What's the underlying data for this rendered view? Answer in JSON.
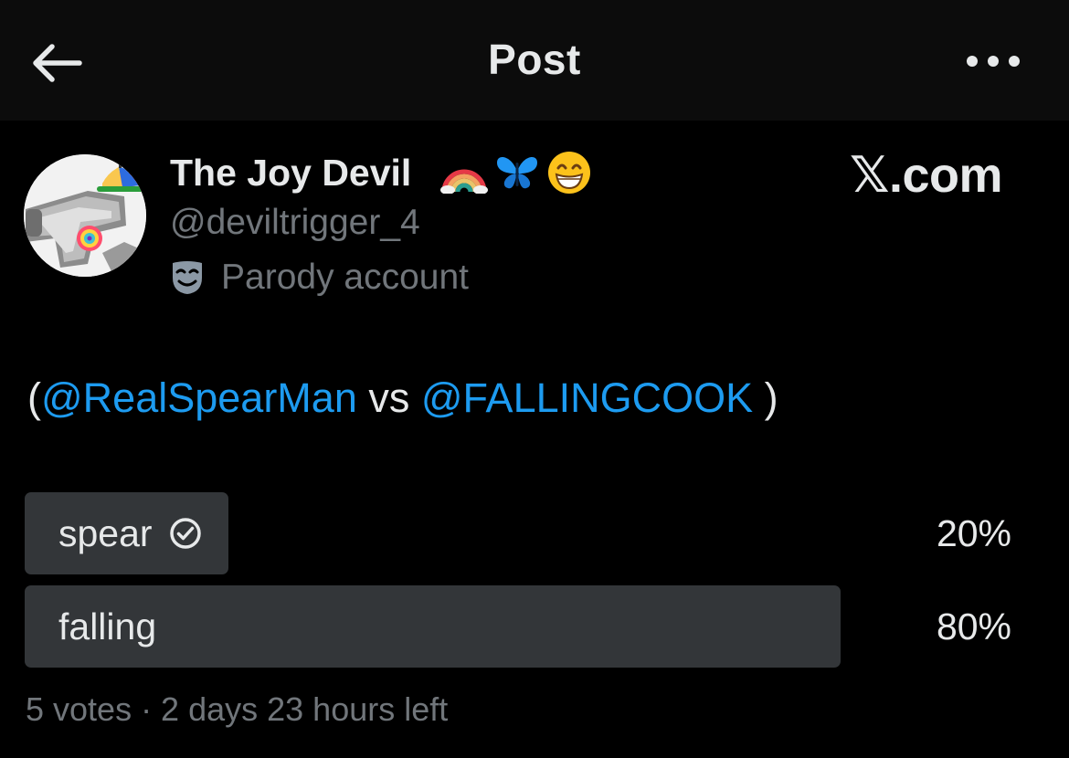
{
  "header": {
    "title": "Post",
    "back_icon": "arrow-left-icon",
    "more_icon": "more-horizontal-icon"
  },
  "author": {
    "display_name": "The Joy Devil",
    "name_emojis": [
      "🌈",
      "🦋",
      "😁"
    ],
    "handle": "@deviltrigger_4",
    "parody_label": "Parody account",
    "parody_icon": "mask-icon"
  },
  "watermark": "𝕏.com",
  "post": {
    "open_paren": "(",
    "mention_1": "@RealSpearMan",
    "vs": " vs ",
    "mention_2": "@FALLINGCOOK",
    "close_paren": " )"
  },
  "poll": {
    "options": [
      {
        "label": "spear",
        "percent_text": "20%",
        "percent": 20,
        "voted": true
      },
      {
        "label": "falling",
        "percent_text": "80%",
        "percent": 80,
        "voted": false
      }
    ],
    "meta": "5 votes · 2 days 23 hours left"
  },
  "colors": {
    "background": "#000000",
    "header_bg": "#0c0c0c",
    "text": "#e7e9ea",
    "secondary_text": "#71767b",
    "link": "#1d9bf0",
    "poll_bar": "#333639"
  }
}
